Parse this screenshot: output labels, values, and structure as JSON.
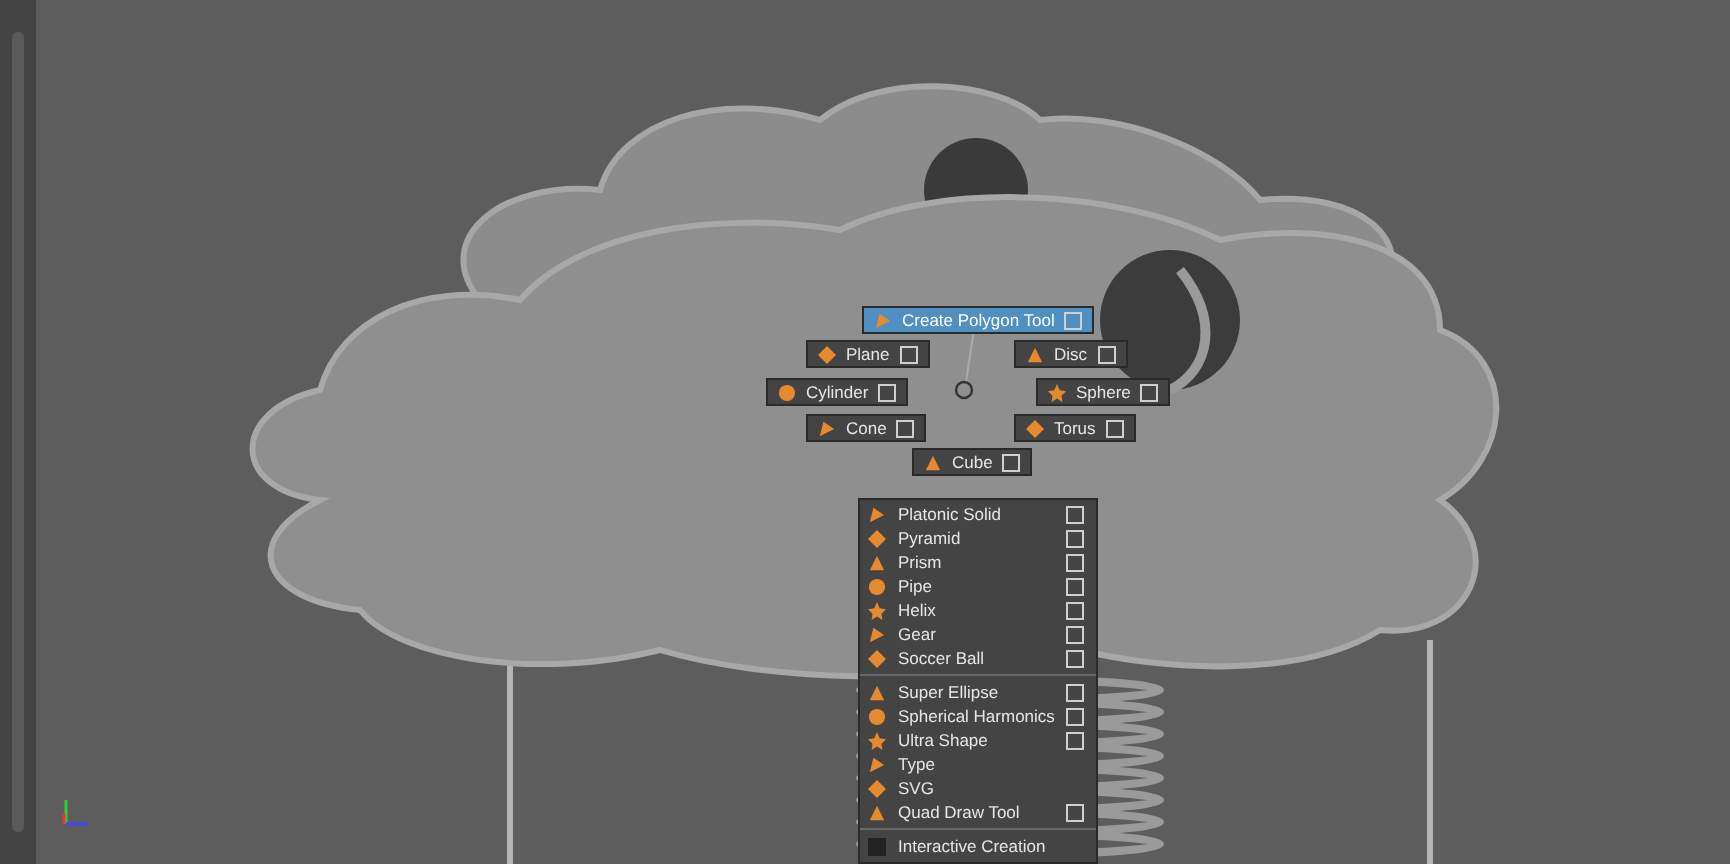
{
  "radial_menu": {
    "items": [
      {
        "label": "Create Polygon Tool",
        "selected": true,
        "option_box": true
      },
      {
        "label": "Plane",
        "selected": false,
        "option_box": true
      },
      {
        "label": "Disc",
        "selected": false,
        "option_box": true
      },
      {
        "label": "Cylinder",
        "selected": false,
        "option_box": true
      },
      {
        "label": "Sphere",
        "selected": false,
        "option_box": true
      },
      {
        "label": "Cone",
        "selected": false,
        "option_box": true
      },
      {
        "label": "Torus",
        "selected": false,
        "option_box": true
      },
      {
        "label": "Cube",
        "selected": false,
        "option_box": true
      }
    ]
  },
  "overflow_menu": {
    "groups": [
      [
        {
          "label": "Platonic Solid",
          "option_box": true
        },
        {
          "label": "Pyramid",
          "option_box": true
        },
        {
          "label": "Prism",
          "option_box": true
        },
        {
          "label": "Pipe",
          "option_box": true
        },
        {
          "label": "Helix",
          "option_box": true
        },
        {
          "label": "Gear",
          "option_box": true
        },
        {
          "label": "Soccer Ball",
          "option_box": true
        }
      ],
      [
        {
          "label": "Super Ellipse",
          "option_box": true
        },
        {
          "label": "Spherical Harmonics",
          "option_box": true
        },
        {
          "label": "Ultra Shape",
          "option_box": true
        },
        {
          "label": "Type",
          "option_box": false
        },
        {
          "label": "SVG",
          "option_box": false
        },
        {
          "label": "Quad Draw Tool",
          "option_box": true
        }
      ],
      [
        {
          "label": "Interactive Creation",
          "checked": false
        }
      ]
    ]
  }
}
